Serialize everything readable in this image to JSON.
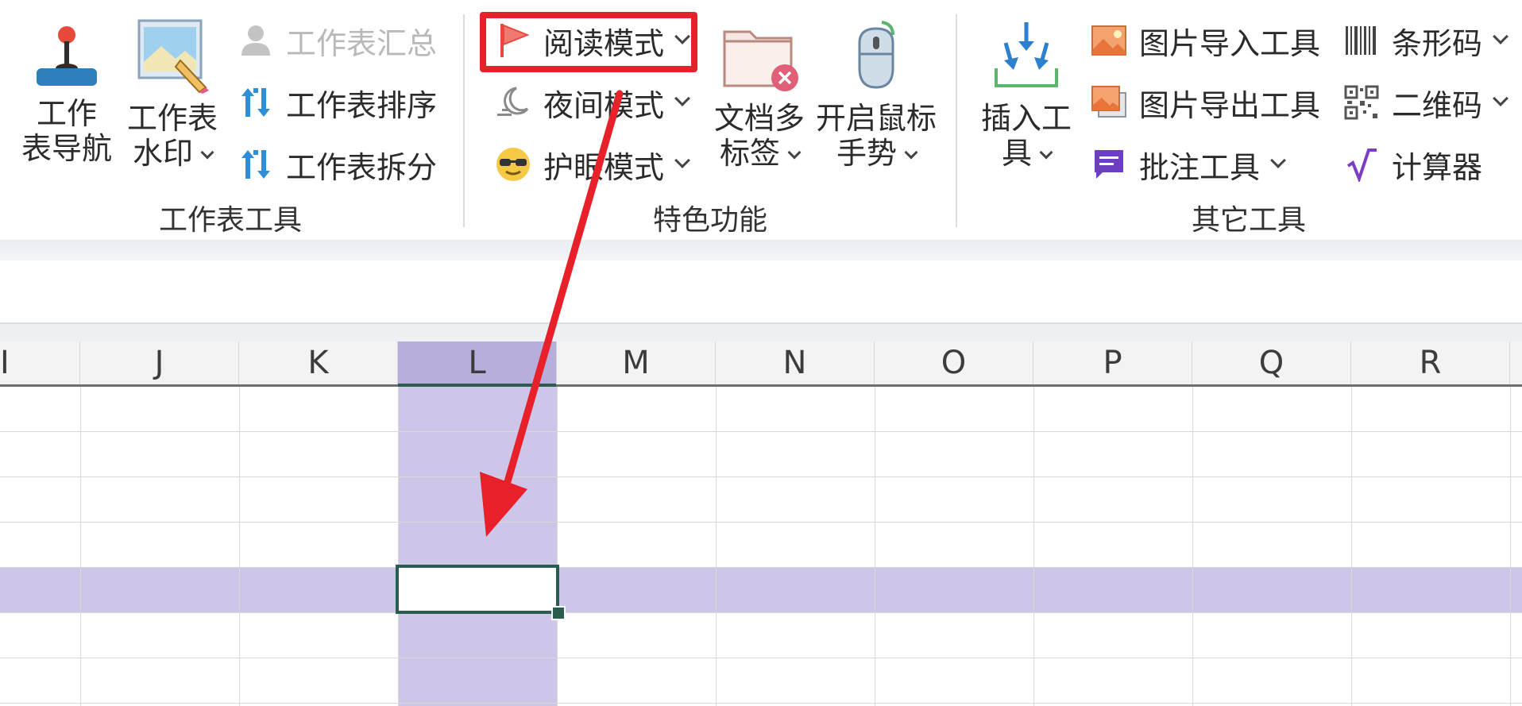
{
  "groups": {
    "worksheet_tools": "工作表工具",
    "special_features": "特色功能",
    "other_tools": "其它工具"
  },
  "worksheet_tools": {
    "nav": "工作\n表导航",
    "watermark": "工作表\n水印",
    "summary": "工作表汇总",
    "sort": "工作表排序",
    "split": "工作表拆分"
  },
  "special_features": {
    "reading_mode": "阅读模式",
    "night_mode": "夜间模式",
    "eye_mode": "护眼模式",
    "multi_tab": "文档多\n标签",
    "mouse_gesture": "开启鼠标\n手势"
  },
  "other_tools": {
    "insert_tool": "插入工\n具",
    "img_import": "图片导入工具",
    "img_export": "图片导出工具",
    "comment_tool": "批注工具",
    "barcode": "条形码",
    "qrcode": "二维码",
    "calculator": "计算器"
  },
  "columns": [
    "I",
    "J",
    "K",
    "L",
    "M",
    "N",
    "O",
    "P",
    "Q",
    "R"
  ],
  "selected_column": "L",
  "colors": {
    "highlight_red": "#e8202a",
    "selection_fill": "#cdc6e9",
    "active_cell_border": "#2a5d4f"
  }
}
